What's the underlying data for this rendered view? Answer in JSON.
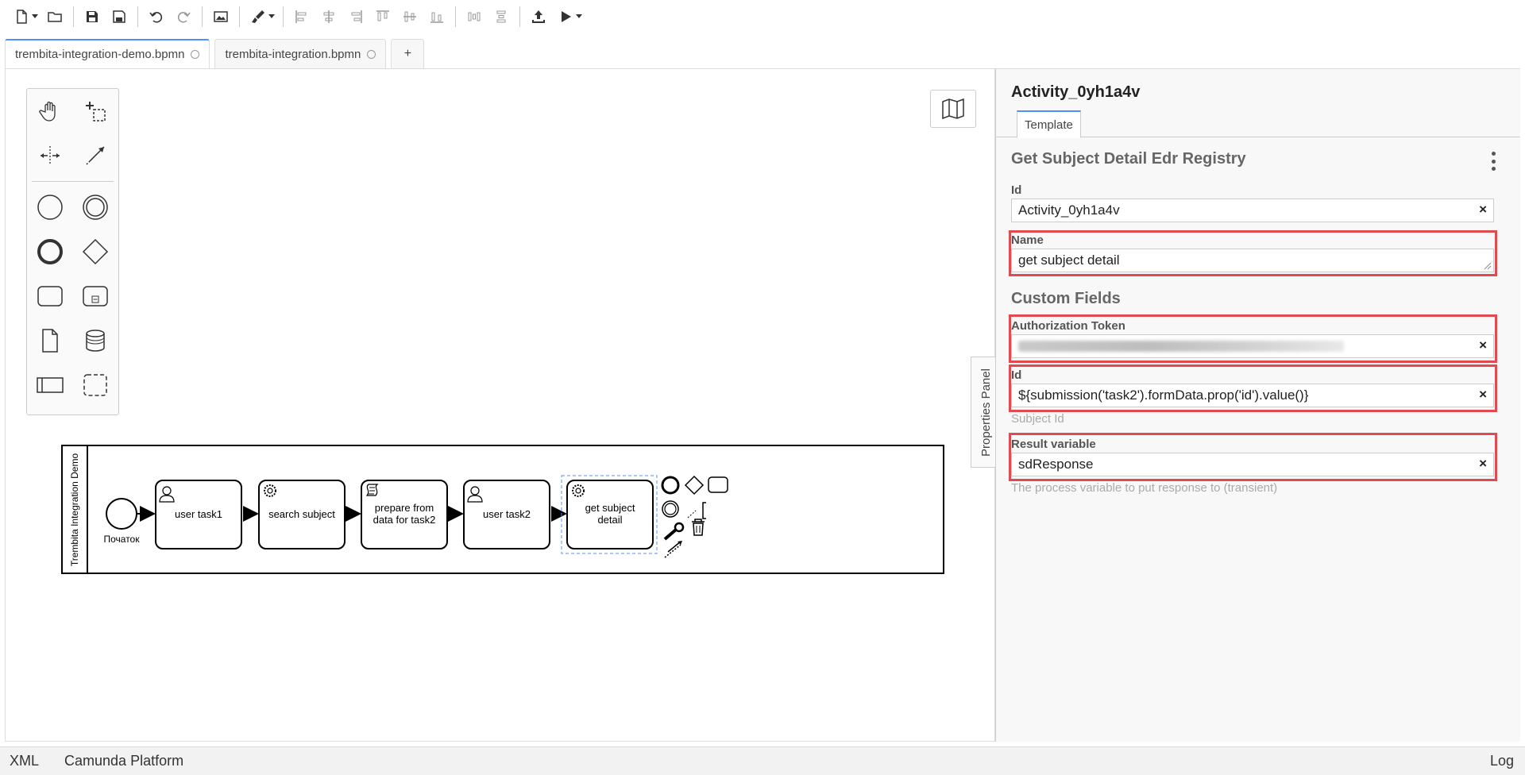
{
  "tabs": [
    {
      "label": "trembita-integration-demo.bpmn"
    },
    {
      "label": "trembita-integration.bpmn"
    },
    {
      "label": "+"
    }
  ],
  "diagram": {
    "pool_label": "Trembita Integration Demo",
    "start_event_label": "Початок",
    "tasks": [
      {
        "label": [
          "user task1"
        ],
        "type": "user-task"
      },
      {
        "label": [
          "search subject"
        ],
        "type": "service-task"
      },
      {
        "label": [
          "prepare from",
          "data for task2"
        ],
        "type": "script-task"
      },
      {
        "label": [
          "user task2"
        ],
        "type": "user-task"
      },
      {
        "label": [
          "get subject",
          "detail"
        ],
        "type": "service-task"
      }
    ]
  },
  "side_tab": {
    "label": "Properties Panel"
  },
  "panel": {
    "title": "Activity_0yh1a4v",
    "tab_label": "Template",
    "section_title": "Get Subject Detail Edr Registry",
    "id_label": "Id",
    "id_value": "Activity_0yh1a4v",
    "name_label": "Name",
    "name_value": "get subject detail",
    "custom_fields_title": "Custom Fields",
    "auth_label": "Authorization Token",
    "custom_id_label": "Id",
    "custom_id_value": "${submission('task2').formData.prop('id').value()}",
    "custom_id_desc": "Subject Id",
    "result_label": "Result variable",
    "result_value": "sdResponse",
    "result_desc": "The process variable to put response to (transient)"
  },
  "statusbar": {
    "xml": "XML",
    "platform": "Camunda Platform",
    "log": "Log"
  }
}
